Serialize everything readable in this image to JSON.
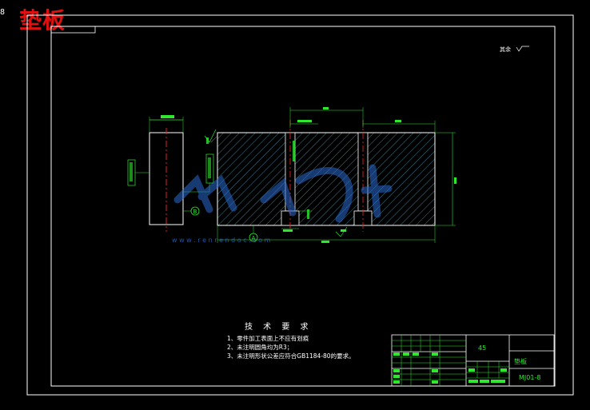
{
  "drawing": {
    "title": "垫板",
    "corner_mark": "8",
    "roughness_note": "其余",
    "material": "45",
    "part_name": "垫板",
    "drawing_no": "MJ01-8"
  },
  "technical_requirements": {
    "heading": "技 术 要 求",
    "items": [
      "1、零件加工表面上不应有划痕",
      "2、未注明圆角均为R3；",
      "3、未注明形状公差应符合GB1184-80的要求。"
    ]
  },
  "datum_labels": {
    "a": "A",
    "b": "B"
  },
  "watermark": {
    "url": "w w w . r e n r e n d o c . c o m"
  },
  "colors": {
    "background": "#000000",
    "lines": "#ffffff",
    "title_red": "#e01010",
    "dimension_green": "#2ee82e",
    "hatch": "#5ab0c8",
    "center_line": "#e02020",
    "watermark": "#2a6acf"
  }
}
